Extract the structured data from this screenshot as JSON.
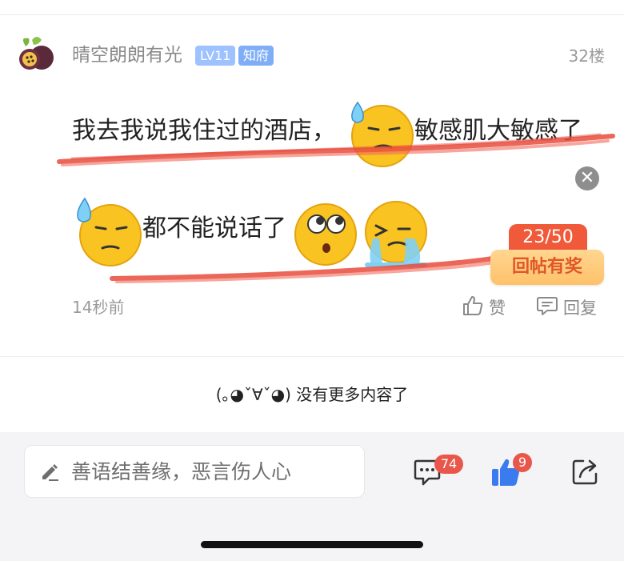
{
  "post": {
    "username": "晴空朗朗有光",
    "level_badge": "LV11",
    "title_badge": "知府",
    "floor": "32楼",
    "line1_part1": "我去我说我住过的酒店，",
    "line1_part2": "敏感肌大敏感了",
    "line2_part1": "都不能说话了",
    "emojis": [
      "sweat-emoji",
      "sweat-emoji",
      "rolling-eyes-emoji",
      "crying-emoji"
    ],
    "time": "14秒前",
    "like_label": "赞",
    "reply_label": "回复",
    "close_symbol": "✕"
  },
  "reward": {
    "count": "23/50",
    "label": "回帖有奖"
  },
  "end_text": "(｡◕ˇ∀ˇ◕) 没有更多内容了",
  "bottom_bar": {
    "input_placeholder": "善语结善缘，恶言伤人心",
    "comment_count": "74",
    "like_count": "9"
  },
  "colors": {
    "accent_blue": "#3a7bf0",
    "badge_red": "#e9564b",
    "reward_orange": "#f05a3a",
    "scribble_red": "#e84c3d"
  }
}
